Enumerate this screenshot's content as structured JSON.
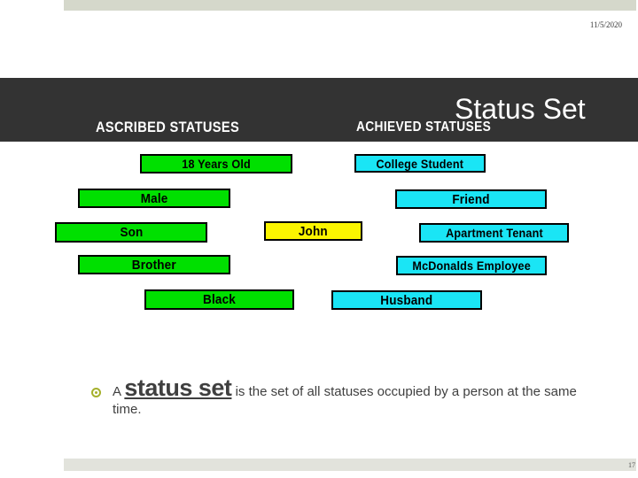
{
  "slide": {
    "title": "Status Set",
    "date": "11/5/2020",
    "page_number": "17",
    "accent_colors": {
      "band_dark": "#333333",
      "bar_sage": "#d5d8cb",
      "bar_sage_bottom": "#e2e3dc",
      "ascribed_box": "#00e000",
      "achieved_box": "#1ae5f5",
      "person_box": "#fbf500",
      "bullet": "#a5b02c",
      "body_text": "#3f3f3f"
    }
  },
  "diagram": {
    "column_headers": {
      "ascribed": "ASCRIBED STATUSES",
      "achieved": "ACHIEVED STATUSES"
    },
    "center_person": {
      "label": "John",
      "color": "#fbf500"
    },
    "ascribed_statuses": [
      {
        "label": "18 Years Old",
        "color": "#00e000"
      },
      {
        "label": "Male",
        "color": "#00e000"
      },
      {
        "label": "Son",
        "color": "#00e000"
      },
      {
        "label": "Brother",
        "color": "#00e000"
      },
      {
        "label": "Black",
        "color": "#00e000"
      }
    ],
    "achieved_statuses": [
      {
        "label": "College Student",
        "color": "#1ae5f5"
      },
      {
        "label": "Friend",
        "color": "#1ae5f5"
      },
      {
        "label": "Apartment Tenant",
        "color": "#1ae5f5"
      },
      {
        "label": "McDonalds Employee",
        "color": "#1ae5f5"
      },
      {
        "label": "Husband",
        "color": "#1ae5f5"
      }
    ]
  },
  "body": {
    "bullet_icon": "target-circle-bullet",
    "lead": "A ",
    "emphasis": "status set",
    "tail": " is the set of all statuses occupied by a person at the same time."
  }
}
